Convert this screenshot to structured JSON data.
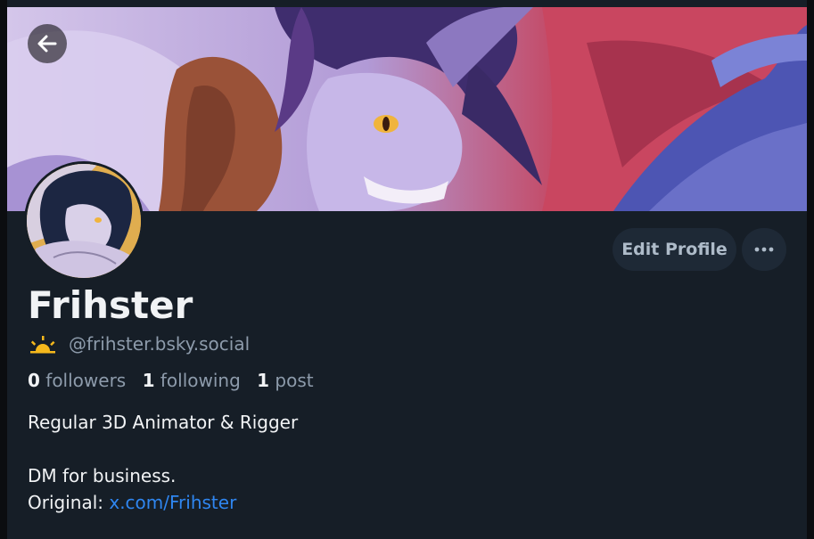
{
  "profile": {
    "display_name": "Frihster",
    "handle": "@frihster.bsky.social",
    "stats": {
      "followers_count": "0",
      "followers_label": "followers",
      "following_count": "1",
      "following_label": "following",
      "posts_count": "1",
      "posts_label": "post"
    },
    "bio": {
      "line1": "Regular 3D Animator & Rigger",
      "line2": "DM for business.",
      "original_label": "Original:",
      "original_link": "x.com/Frihster"
    }
  },
  "actions": {
    "edit_profile_label": "Edit Profile"
  },
  "icons": {
    "back": "arrow-left-icon",
    "more": "ellipsis-icon",
    "handle_badge": "sunrise-icon"
  },
  "colors": {
    "background": "#161e27",
    "button_bg": "#1e2936",
    "text_primary": "#f1f3f5",
    "text_secondary": "#8d9bab",
    "link": "#2f86f0",
    "sun_icon": "#f5b81c"
  }
}
